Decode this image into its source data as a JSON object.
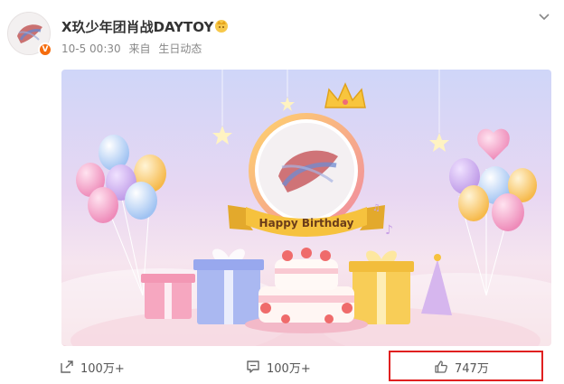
{
  "post": {
    "username": "X玖少年团肖战DAYTOY",
    "timestamp": "10-5 00:30",
    "source_prefix": "来自",
    "source": "生日动态",
    "verified_badge": "V"
  },
  "image": {
    "banner_text": "Happy Birthday"
  },
  "actions": {
    "repost_count": "100万+",
    "comment_count": "100万+",
    "like_count": "747万"
  },
  "icons": {
    "user_badge": "crown-gold-icon",
    "collapse": "chevron-down-icon",
    "repost": "repost-icon",
    "comment": "comment-icon",
    "like": "thumbs-up-icon"
  },
  "colors": {
    "highlight_box": "#e02020",
    "verified_badge": "#f56c0d",
    "banner_ribbon": "#f6c23e"
  }
}
